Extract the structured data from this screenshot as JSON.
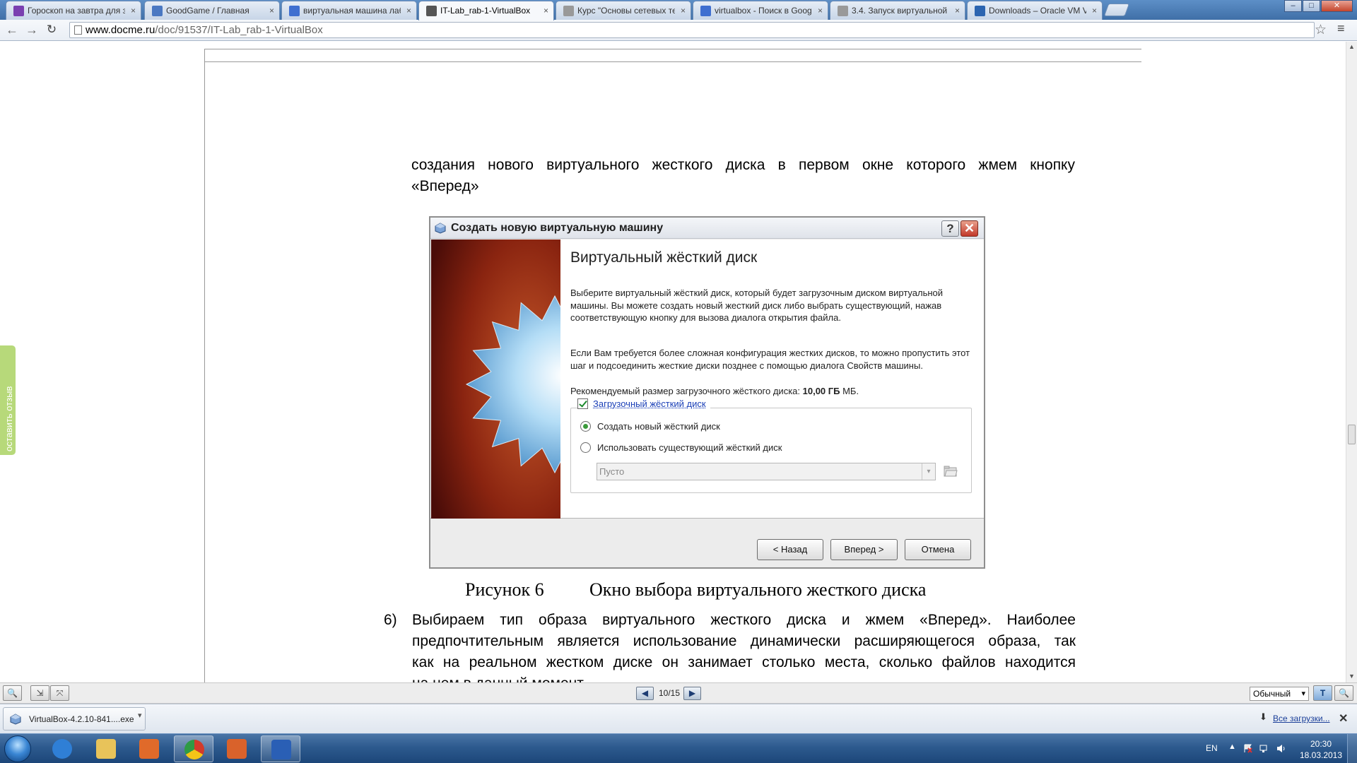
{
  "browser": {
    "tabs": [
      {
        "title": "Гороскоп на завтра для з",
        "favicon_color": "#7a3fb0",
        "active": false
      },
      {
        "title": "GoodGame / Главная",
        "favicon_color": "#4a78c2",
        "active": false
      },
      {
        "title": "виртуальная машина лаб",
        "favicon_color": "#3f6fd0",
        "active": false
      },
      {
        "title": "IT-Lab_rab-1-VirtualBox",
        "favicon_color": "#555555",
        "active": true
      },
      {
        "title": "Курс \"Основы сетевых те",
        "favicon_color": "#999999",
        "active": false
      },
      {
        "title": "virtualbox - Поиск в Goog",
        "favicon_color": "#3f6fd0",
        "active": false
      },
      {
        "title": "3.4. Запуск виртуальной",
        "favicon_color": "#999999",
        "active": false
      },
      {
        "title": "Downloads – Oracle VM V",
        "favicon_color": "#2b64b0",
        "active": false
      }
    ],
    "tab_close_glyph": "×",
    "window_controls": {
      "minimize": "–",
      "maximize": "□",
      "close": "✕"
    },
    "url_host": "www.docme.ru",
    "url_path": "/doc/91537/IT-Lab_rab-1-VirtualBox",
    "nav": {
      "back": "←",
      "forward": "→",
      "reload": "↻",
      "star": "☆",
      "menu": "≡"
    }
  },
  "document": {
    "para1_lines": [
      "создания нового виртуального жесткого диска в первом окне которого жмем кнопку",
      "«Вперед»"
    ],
    "caption_number": "Рисунок 6",
    "caption_text": "Окно выбора виртуального жесткого диска",
    "list_number": "6)",
    "para2_lines": [
      "Выбираем тип образа виртуального жесткого диска и жмем «Вперед». Наиболее",
      "предпочтительным является использование динамически расширяющегося образа, так",
      "как на реальном жестком диске он занимает столько места, сколько файлов находится",
      "на нем в данный момент."
    ]
  },
  "dialog": {
    "title": "Создать новую виртуальную машину",
    "help_glyph": "?",
    "close_glyph": "✕",
    "heading": "Виртуальный жёсткий диск",
    "p1": "Выберите виртуальный жёсткий диск, который будет загрузочным диском виртуальной машины. Вы можете создать новый жесткий диск либо выбрать существующий, нажав соответствующую кнопку для вызова диалога открытия файла.",
    "p2": "Если Вам требуется более сложная конфигурация жестких дисков, то можно пропустить этот шаг и подсоединить жесткие диски позднее с помощью диалога Свойств машины.",
    "p3_prefix": "Рекомендуемый размер загрузочного жёсткого диска: ",
    "p3_value": "10,00 ГБ",
    "p3_suffix": " МБ.",
    "boot_checkbox_label": "Загрузочный жёсткий диск",
    "boot_checked": true,
    "radio_create_label": "Создать новый жёсткий диск",
    "radio_existing_label": "Использовать существующий жёсткий диск",
    "combo_value": "Пусто",
    "combo_arrow": "▾",
    "btn_back": "< Назад",
    "btn_next": "Вперед >",
    "btn_cancel": "Отмена"
  },
  "feedback_tab": "оставить отзыв",
  "viewer": {
    "page_indicator": "10/15",
    "prev_glyph": "◀",
    "next_glyph": "▶",
    "zoom_mode": "Обычный",
    "tool_glyphs": [
      "🔍",
      "⇲",
      "⤧"
    ],
    "right_tool_glyphs": [
      "T",
      "🔍"
    ]
  },
  "downloads": {
    "file_name": "VirtualBox-4.2.10-841....exe",
    "menu_glyph": "▾",
    "show_all": "Все загрузки...",
    "arrow_glyph": "⬇",
    "close_glyph": "✕"
  },
  "taskbar": {
    "apps": [
      {
        "name": "internet-explorer",
        "color": "#2f7fd6"
      },
      {
        "name": "file-explorer",
        "color": "#e8c35a"
      },
      {
        "name": "media-player",
        "color": "#e06a2a"
      },
      {
        "name": "chrome",
        "color": "#d23b2b"
      },
      {
        "name": "matlab",
        "color": "#d9622b"
      },
      {
        "name": "word",
        "color": "#2a5fb5"
      }
    ],
    "lang": "EN",
    "tray_up_glyph": "▲",
    "time": "20:30",
    "date": "18.03.2013"
  },
  "colors": {
    "dialog_art_dark": "#5a0f0a",
    "dialog_art_light": "#c85a2a",
    "star_blue": "#7fc3ee",
    "accent_link": "#1a3fb7",
    "feedback_green": "#b7d97a"
  }
}
